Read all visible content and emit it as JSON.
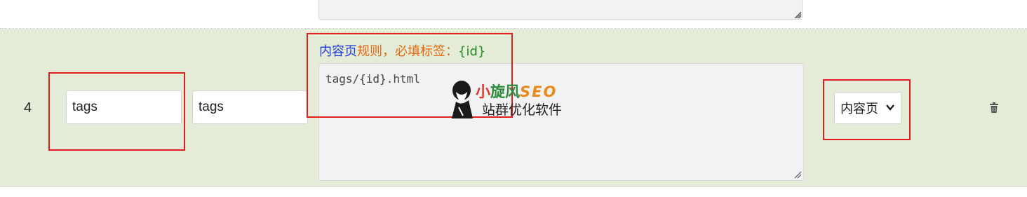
{
  "row": {
    "number": "4",
    "name_value": "tags",
    "dir_value": "tags",
    "rule_label": {
      "part1": "内容页",
      "part2": "规则，必填标签：",
      "part3": "{id}"
    },
    "rule_value": "tags/{id}.html",
    "page_type_selected": "内容页"
  },
  "watermark": {
    "brand_part1": "小",
    "brand_part2": "旋风",
    "brand_part3": "SEO",
    "tagline": "站群优化软件"
  },
  "colors": {
    "row_background": "#e4ecd8",
    "highlight_box": "#e01e1e",
    "label_blue": "#1a35d8",
    "label_orange": "#e36a10",
    "label_green": "#1f8a1f"
  },
  "icons": {
    "delete": "trash-icon",
    "select_arrow": "chevron-down-icon"
  }
}
